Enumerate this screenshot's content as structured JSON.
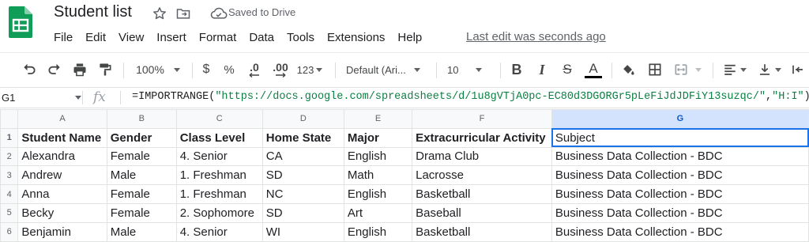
{
  "doc": {
    "title": "Student list",
    "saved_status": "Saved to Drive",
    "last_edit": "Last edit was seconds ago"
  },
  "menu": [
    "File",
    "Edit",
    "View",
    "Insert",
    "Format",
    "Data",
    "Tools",
    "Extensions",
    "Help"
  ],
  "toolbar": {
    "zoom": "100%",
    "currency": "$",
    "percent": "%",
    "decrease_decimals": ".0",
    "increase_decimals": ".00",
    "more_formats": "123",
    "font": "Default (Ari...",
    "font_size": "10",
    "bold": "B",
    "italic": "I",
    "strikethrough": "S",
    "text_color": "A"
  },
  "formula_bar": {
    "cell_ref": "G1",
    "fx": "fx",
    "formula_prefix": "=IMPORTRANGE(",
    "formula_url": "\"https://docs.google.com/spreadsheets/d/1u8gVTjA0pc-EC80d3DGORGr5pLeFiJdJDFiY13suzqc/\"",
    "formula_comma": ",",
    "formula_range": "\"H:I\"",
    "formula_suffix": ")"
  },
  "grid": {
    "columns": [
      "A",
      "B",
      "C",
      "D",
      "E",
      "F",
      "G"
    ],
    "row_numbers": [
      "1",
      "2",
      "3",
      "4",
      "5",
      "6"
    ],
    "rows": [
      [
        "Student Name",
        "Gender",
        "Class Level",
        "Home State",
        "Major",
        "Extracurricular Activity",
        "Subject"
      ],
      [
        "Alexandra",
        "Female",
        "4. Senior",
        "CA",
        "English",
        "Drama Club",
        "Business Data Collection - BDC"
      ],
      [
        "Andrew",
        "Male",
        "1. Freshman",
        "SD",
        "Math",
        "Lacrosse",
        "Business Data Collection - BDC"
      ],
      [
        "Anna",
        "Female",
        "1. Freshman",
        "NC",
        "English",
        "Basketball",
        "Business Data Collection - BDC"
      ],
      [
        "Becky",
        "Female",
        "2. Sophomore",
        "SD",
        "Art",
        "Baseball",
        "Business Data Collection - BDC"
      ],
      [
        "Benjamin",
        "Male",
        "4. Senior",
        "WI",
        "English",
        "Basketball",
        "Business Data Collection - BDC"
      ]
    ]
  },
  "colors": {
    "sheets_green": "#0f9d58",
    "selection_blue": "#1a73e8",
    "formula_string_green": "#0b8043"
  }
}
